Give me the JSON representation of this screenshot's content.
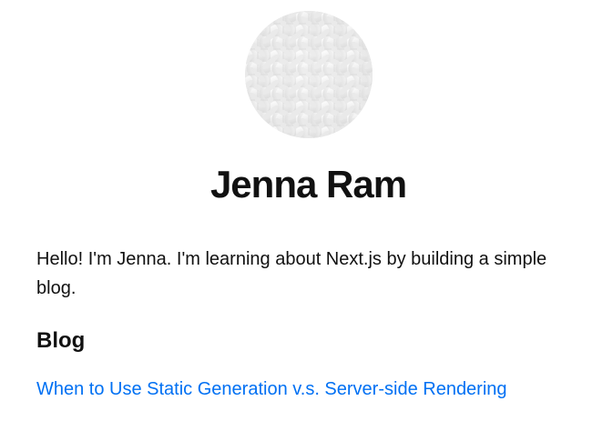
{
  "profile": {
    "name": "Jenna Ram",
    "avatar_icon": "woven-texture-avatar-icon",
    "intro": "Hello! I'm Jenna. I'm learning about Next.js by building a simple blog."
  },
  "blog": {
    "heading": "Blog",
    "posts": [
      {
        "title": "When to Use Static Generation v.s. Server-side Rendering"
      }
    ]
  },
  "colors": {
    "text": "#111111",
    "link": "#0070f3",
    "background": "#ffffff"
  }
}
